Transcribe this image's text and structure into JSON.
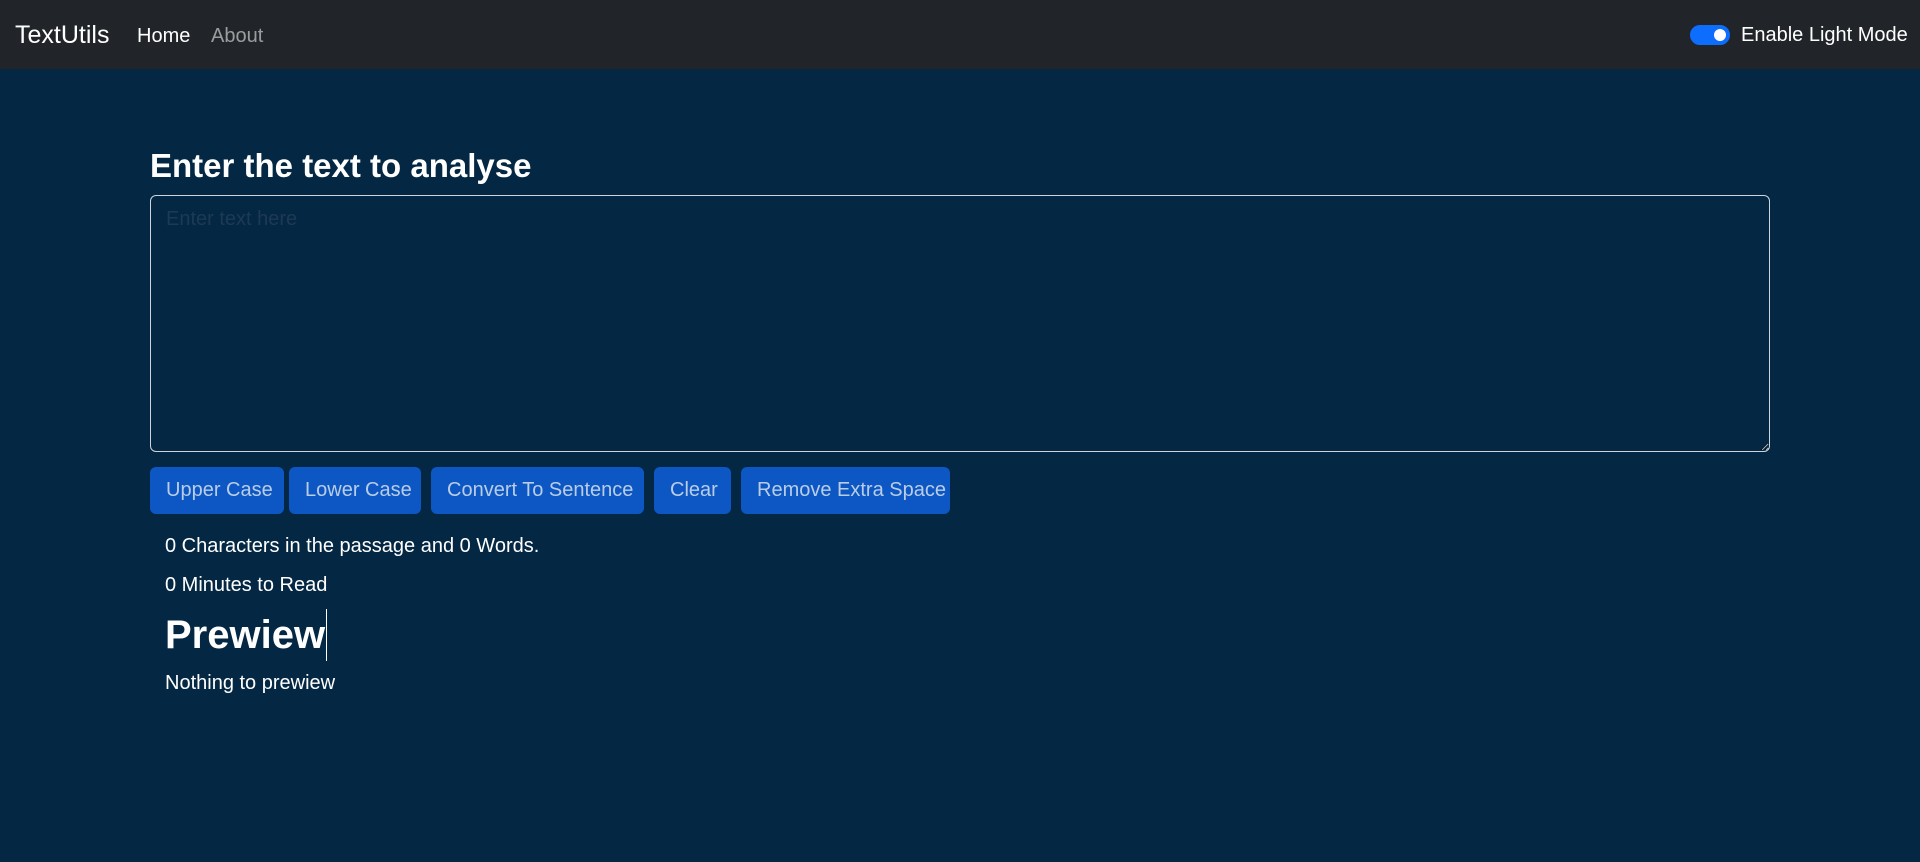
{
  "navbar": {
    "brand": "TextUtils",
    "links": [
      {
        "label": "Home",
        "active": true
      },
      {
        "label": "About",
        "active": false
      }
    ],
    "mode_toggle": {
      "label": "Enable Light Mode",
      "checked": true
    }
  },
  "main": {
    "heading": "Enter the text to analyse",
    "textarea": {
      "value": "",
      "placeholder": "Enter text here"
    },
    "buttons": [
      {
        "label": "Upper Case"
      },
      {
        "label": "Lower Case"
      },
      {
        "label": "Convert To Sentence"
      },
      {
        "label": "Clear"
      },
      {
        "label": "Remove Extra Space"
      }
    ],
    "summary": {
      "counts": "0 Characters in the passage and 0 Words.",
      "read_time": "0 Minutes to Read"
    },
    "preview": {
      "title": "Prewiew",
      "text": "Nothing to prewiew"
    }
  },
  "colors": {
    "page_bg": "#042743",
    "navbar_bg": "#212529",
    "button_bg": "#0d57c4",
    "toggle_accent": "#0d6efd"
  }
}
